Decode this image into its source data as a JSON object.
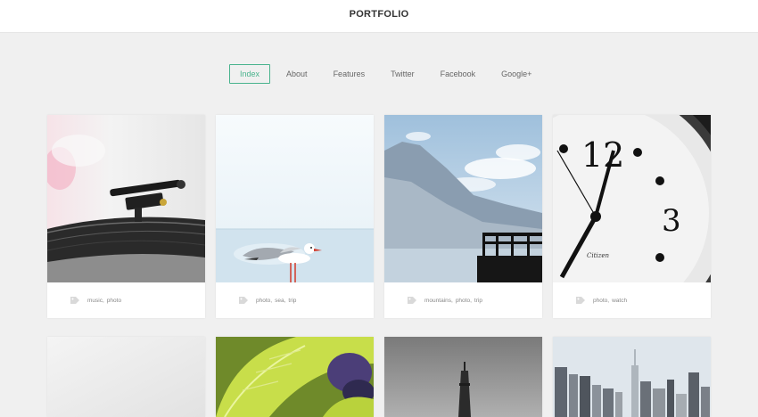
{
  "header": {
    "title": "PORTFOLIO"
  },
  "nav": [
    {
      "label": "Index",
      "active": true
    },
    {
      "label": "About"
    },
    {
      "label": "Features"
    },
    {
      "label": "Twitter"
    },
    {
      "label": "Facebook"
    },
    {
      "label": "Google+"
    }
  ],
  "cards": [
    {
      "image": "turntable-photo",
      "tags": [
        "music",
        "photo"
      ]
    },
    {
      "image": "seagull-photo",
      "tags": [
        "photo",
        "sea",
        "trip"
      ]
    },
    {
      "image": "mountains-pier-photo",
      "tags": [
        "mountains",
        "photo",
        "trip"
      ]
    },
    {
      "image": "clock-photo",
      "tags": [
        "photo",
        "watch"
      ]
    },
    {
      "image": "blank-photo"
    },
    {
      "image": "leaf-photo"
    },
    {
      "image": "eiffel-tower-photo"
    },
    {
      "image": "city-skyline-photo"
    }
  ],
  "icons": {
    "tag": "tag-icon"
  },
  "colors": {
    "accent": "#49b38d",
    "background": "#f0f0f0"
  }
}
